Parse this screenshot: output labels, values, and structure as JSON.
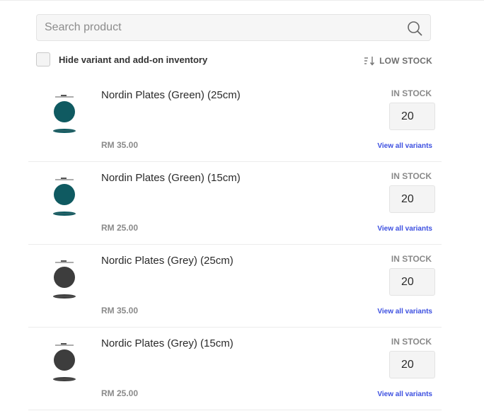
{
  "search": {
    "placeholder": "Search product",
    "value": ""
  },
  "filter": {
    "hide_variants_label": "Hide variant and add-on inventory",
    "hide_variants_checked": false
  },
  "sort": {
    "label": "LOW STOCK"
  },
  "colors": {
    "link": "#3c4fe0",
    "teal_plate": "#0f5a61",
    "grey_plate": "#3d3d3d"
  },
  "products": [
    {
      "name": "Nordin Plates (Green) (25cm)",
      "price": "RM 35.00",
      "stock_status": "IN STOCK",
      "quantity": "20",
      "link": "View all variants",
      "thumb_color": "#0f5a61"
    },
    {
      "name": "Nordin Plates (Green) (15cm)",
      "price": "RM 25.00",
      "stock_status": "IN STOCK",
      "quantity": "20",
      "link": "View all variants",
      "thumb_color": "#0f5a61"
    },
    {
      "name": "Nordic Plates (Grey) (25cm)",
      "price": "RM 35.00",
      "stock_status": "IN STOCK",
      "quantity": "20",
      "link": "View all variants",
      "thumb_color": "#3d3d3d"
    },
    {
      "name": "Nordic Plates (Grey) (15cm)",
      "price": "RM 25.00",
      "stock_status": "IN STOCK",
      "quantity": "20",
      "link": "View all variants",
      "thumb_color": "#3d3d3d"
    }
  ]
}
